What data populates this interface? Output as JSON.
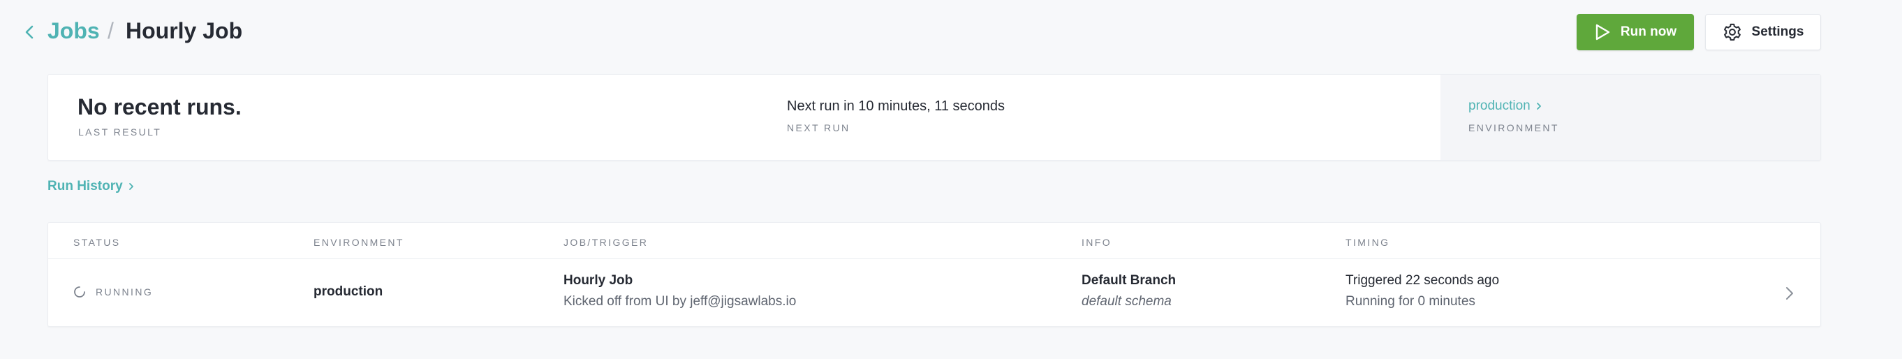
{
  "header": {
    "breadcrumb_root": "Jobs",
    "breadcrumb_separator": "/",
    "title": "Hourly Job",
    "run_now_label": "Run now",
    "settings_label": "Settings"
  },
  "summary": {
    "last_result_value": "No recent runs.",
    "last_result_label": "LAST RESULT",
    "next_run_value": "Next run in 10 minutes, 11 seconds",
    "next_run_label": "NEXT RUN",
    "environment_value": "production",
    "environment_label": "ENVIRONMENT"
  },
  "run_history": {
    "link_label": "Run History"
  },
  "table": {
    "columns": [
      "STATUS",
      "ENVIRONMENT",
      "JOB/TRIGGER",
      "INFO",
      "TIMING"
    ],
    "rows": [
      {
        "status": "RUNNING",
        "environment": "production",
        "job_name": "Hourly Job",
        "trigger": "Kicked off from UI by jeff@jigsawlabs.io",
        "branch": "Default Branch",
        "schema": "default schema",
        "triggered": "Triggered 22 seconds ago",
        "duration": "Running for 0 minutes"
      }
    ]
  },
  "colors": {
    "accent": "#4fb3b3",
    "primary_button": "#5fa83b",
    "text": "#262a33",
    "muted": "#7d838e",
    "background": "#f7f8fa"
  },
  "icons": {
    "back": "chevron-left-icon",
    "run_now": "play-icon",
    "settings": "gear-icon",
    "running": "spinner-icon",
    "row_open": "chevron-right-icon"
  }
}
